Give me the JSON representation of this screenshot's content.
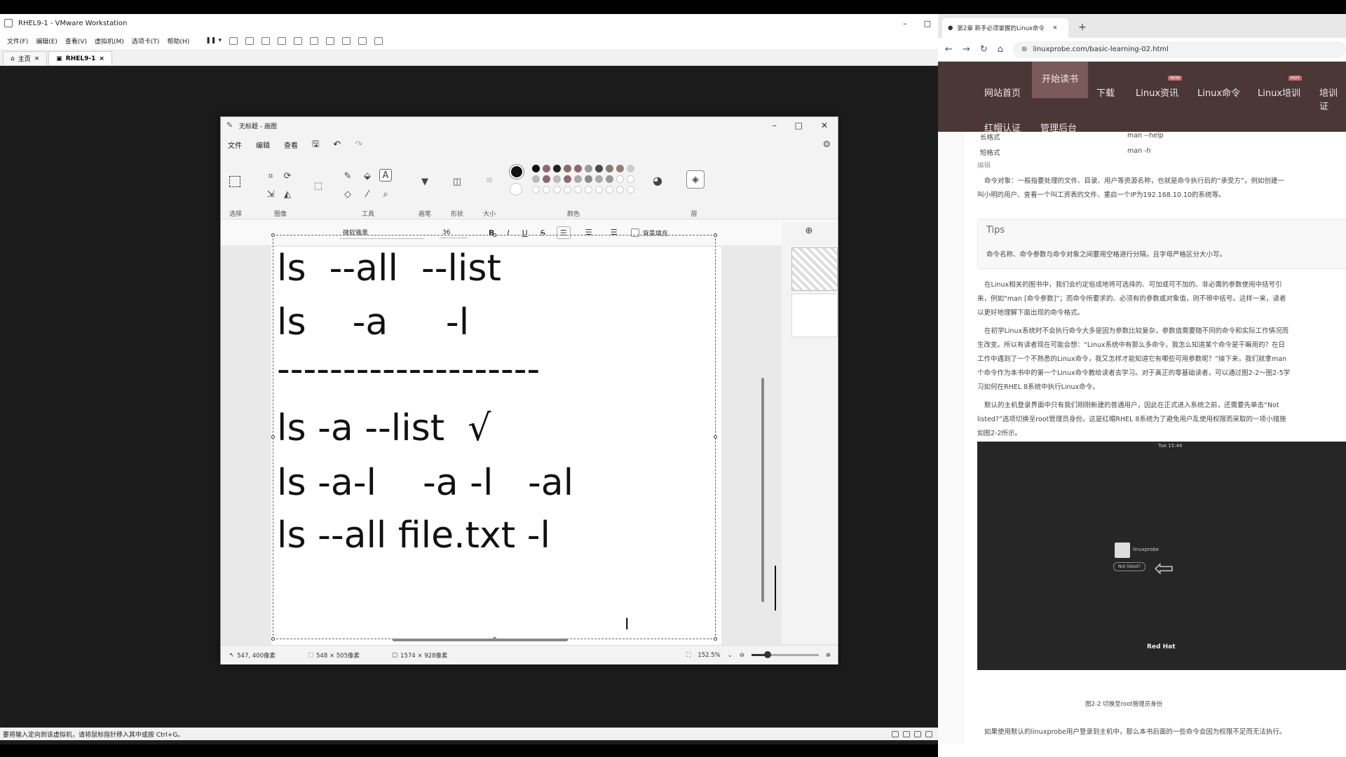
{
  "vmware": {
    "title": "RHEL9-1 - VMware Workstation",
    "menu": [
      "文件(F)",
      "编辑(E)",
      "查看(V)",
      "虚拟机(M)",
      "选项卡(T)",
      "帮助(H)"
    ],
    "tabs": [
      {
        "label": "主页"
      },
      {
        "label": "RHEL9-1"
      }
    ],
    "status": "要将输入定向到该虚拟机，请将鼠标指针移入其中或按 Ctrl+G。"
  },
  "paint": {
    "title": "无标题 - 画图",
    "menu": [
      "文件",
      "编辑",
      "查看"
    ],
    "groups": {
      "select": "选择",
      "image": "图像",
      "tools": "工具",
      "brush": "画笔",
      "shapes": "形状",
      "size": "大小",
      "colors": "颜色",
      "layers": "层"
    },
    "textbar": {
      "font": "微软雅黑",
      "size": "36",
      "bold": "B",
      "italic": "I",
      "underline": "U",
      "strike": "S",
      "fill_label": "背景填充"
    },
    "canvas_lines": [
      "ls  --all  --list",
      "ls    -a     -l",
      "--------------------",
      "ls -a --list  √",
      "ls -a-l    -a -l   -al",
      "ls --all file.txt -l"
    ],
    "status": {
      "cursor": "547, 400像素",
      "selection": "548 × 505像素",
      "canvas": "1574 × 928像素",
      "zoom": "152.5%"
    },
    "palette": [
      "#111111",
      "#8a6a6a",
      "#222222",
      "#8a6a6a",
      "#8a6a6a",
      "#9a9a9a",
      "#4a4a4a",
      "#8a7a7a",
      "#9a7a7a",
      "#cccccc",
      "#bbbbbb",
      "#8a6a6a",
      "#bbbbbb",
      "#8a6a6a",
      "#aaaaaa",
      "#8a8a8a",
      "#aaaaaa",
      "#999999"
    ]
  },
  "browser": {
    "tab_title": "第2章 新手必须掌握的Linux命令",
    "url": "linuxprobe.com/basic-learning-02.html",
    "nav": [
      "网站首页",
      "开始读书",
      "下载",
      "Linux资讯",
      "Linux命令",
      "Linux培训",
      "培训证",
      "红帽认证",
      "管理后台"
    ],
    "content": {
      "row1_label": "长格式",
      "row1_value": "man --help",
      "row2_label": "短格式",
      "row2_value": "man -h",
      "edit": "编辑",
      "p1": "命令对象：一般指要处理的文件、目录、用户等资源名称，也就是命令执行后的“承受方”，例如创建一",
      "p1b": "叫小明的用户、查看一个叫工资表的文件、重启一个IP为192.168.10.10的系统等。",
      "tips_title": "Tips",
      "tips_text": "命令名称、命令参数与命令对象之间要用空格进行分隔，且字母严格区分大小写。",
      "p2a": "在Linux相关的图书中，我们会约定俗成地将可选择的、可加或可不加的、非必需的参数使用中括号引",
      "p2b": "来，例如“man [命令参数]”；而命令所要求的、必须有的参数或对象值，则不带中括号。这样一来，读者",
      "p2c": "以更好地理解下面出现的命令格式。",
      "p3a": "在初学Linux系统时不会执行命令大多是因为参数比较复杂，参数值需要随不同的命令和实际工作情况而",
      "p3b": "生改变。所以有读者现在可能会想：“Linux系统中有那么多命令，我怎么知道某个命令是干嘛用的？在日",
      "p3c": "工作中遇到了一个不熟悉的Linux命令，我又怎样才能知道它有哪些可用参数呢？”接下来，我们就拿man",
      "p3d": "个命令作为本书中的第一个Linux命令教给读者去学习。对于真正的零基础读者，可以通过图2-2～图2-5学",
      "p3e": "习如何在RHEL 8系统中执行Linux命令。",
      "p4a": "默认的主机登录界面中只有我们刚刚新建的普通用户，因此在正式进入系统之前，还需要先单击“Not",
      "p4b": "listed?”选项切换至root管理员身份。这是红帽RHEL 8系统为了避免用户乱使用权限而采取的一项小措施",
      "p4c": "如图2-2所示。",
      "shot_time": "Tue 15:44",
      "shot_user": "linuxprobe",
      "shot_notlisted": "Not listed?",
      "shot_brand": "Red Hat",
      "caption": "图2-2 切换至root管理员身份",
      "p5": "如果使用默认的linuxprobe用户登录到主机中，那么本书后面的一些命令会因为权限不足而无法执行。"
    }
  }
}
